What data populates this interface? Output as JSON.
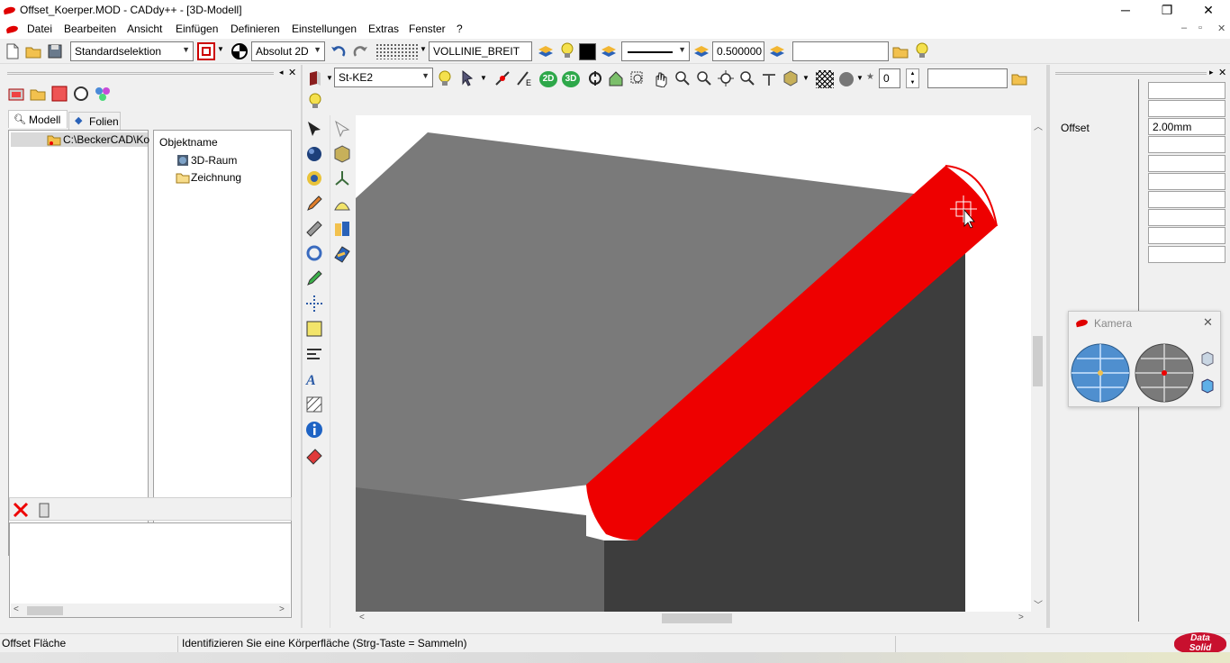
{
  "window": {
    "title": "Offset_Koerper.MOD  -  CADdy++ - [3D-Modell]",
    "min_glyph": "─",
    "max_glyph": "❐",
    "close_glyph": "✕"
  },
  "menu": {
    "items": [
      "Datei",
      "Bearbeiten",
      "Ansicht",
      "Einfügen",
      "Definieren",
      "Einstellungen",
      "Extras",
      "Fenster",
      "?"
    ],
    "mdi_min": "–",
    "mdi_restore": "▫",
    "mdi_close": "✕"
  },
  "toolbar": {
    "selection_mode": "Standardselektion",
    "coord_mode": "Absolut 2D",
    "line_style": "VOLLINIE_BREIT",
    "line_width": "0.500000",
    "extra_field": ""
  },
  "toolbar2": {
    "layer": "St-KE2",
    "mode_2d": "2D",
    "mode_3d": "3D",
    "counter": "0",
    "search": ""
  },
  "left_panel": {
    "tabs": [
      "Modell",
      "Folien"
    ],
    "tree_path": "C:\\BeckerCAD\\Ko",
    "objects_header": "Objektname",
    "objects": [
      "3D-Raum",
      "Zeichnung"
    ]
  },
  "properties": {
    "offset_label": "Offset",
    "offset_value": "2.00mm"
  },
  "kamera": {
    "title": "Kamera"
  },
  "status": {
    "left": "Offset Fläche",
    "message": "Identifizieren Sie eine Körperfläche (Strg-Taste = Sammeln)"
  },
  "brand": {
    "line1": "Data",
    "line2": "Solid"
  },
  "colors": {
    "highlight": "#ee0000",
    "body_top": "#7a7a7a",
    "body_front": "#666666",
    "body_side": "#3d3d3d"
  }
}
